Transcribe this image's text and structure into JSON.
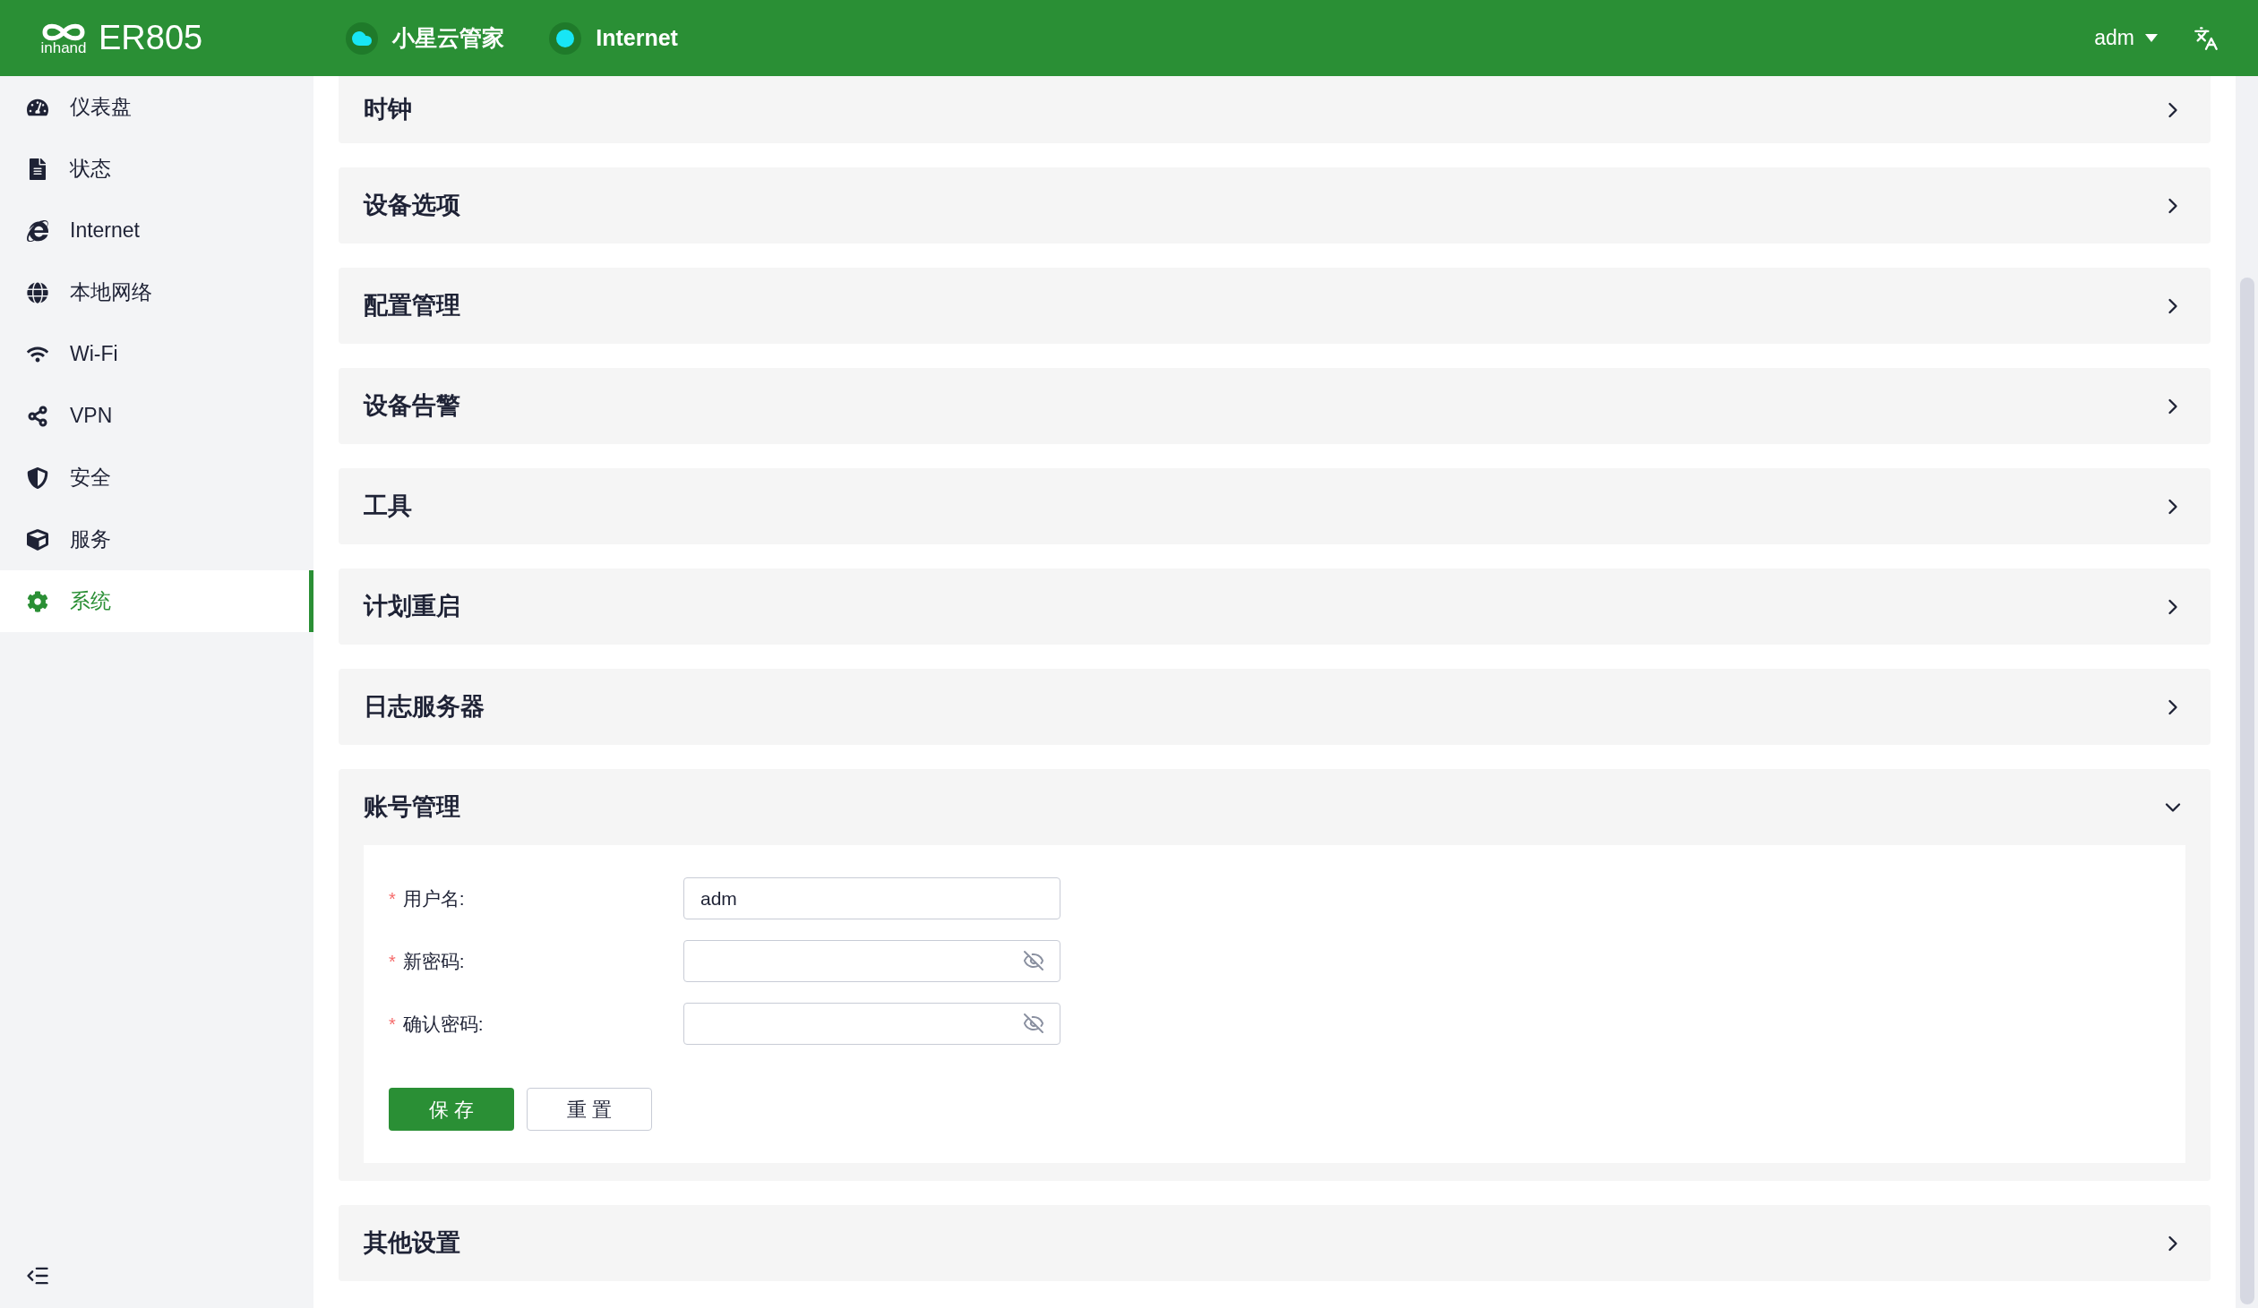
{
  "header": {
    "logo_text": "inhand",
    "product": "ER805",
    "status": [
      {
        "kind": "cloud",
        "label": "小星云管家"
      },
      {
        "kind": "dot",
        "label": "Internet"
      }
    ],
    "user": "adm"
  },
  "sidebar": {
    "items": [
      {
        "label": "仪表盘",
        "selected": false
      },
      {
        "label": "状态",
        "selected": false
      },
      {
        "label": "Internet",
        "selected": false
      },
      {
        "label": "本地网络",
        "selected": false
      },
      {
        "label": "Wi-Fi",
        "selected": false
      },
      {
        "label": "VPN",
        "selected": false
      },
      {
        "label": "安全",
        "selected": false
      },
      {
        "label": "服务",
        "selected": false
      },
      {
        "label": "系统",
        "selected": true
      }
    ]
  },
  "sections": [
    {
      "title": "时钟",
      "expanded": false
    },
    {
      "title": "设备选项",
      "expanded": false
    },
    {
      "title": "配置管理",
      "expanded": false
    },
    {
      "title": "设备告警",
      "expanded": false
    },
    {
      "title": "工具",
      "expanded": false
    },
    {
      "title": "计划重启",
      "expanded": false
    },
    {
      "title": "日志服务器",
      "expanded": false
    },
    {
      "title": "账号管理",
      "expanded": true,
      "form": {
        "fields": [
          {
            "required_mark": "*",
            "label": "用户名:",
            "kind": "text",
            "value": "adm"
          },
          {
            "required_mark": "*",
            "label": "新密码:",
            "kind": "password"
          },
          {
            "required_mark": "*",
            "label": "确认密码:",
            "kind": "password"
          }
        ],
        "buttons": [
          {
            "label": "保 存",
            "kind": "primary"
          },
          {
            "label": "重 置",
            "kind": "default"
          }
        ]
      }
    },
    {
      "title": "其他设置",
      "expanded": false
    }
  ]
}
